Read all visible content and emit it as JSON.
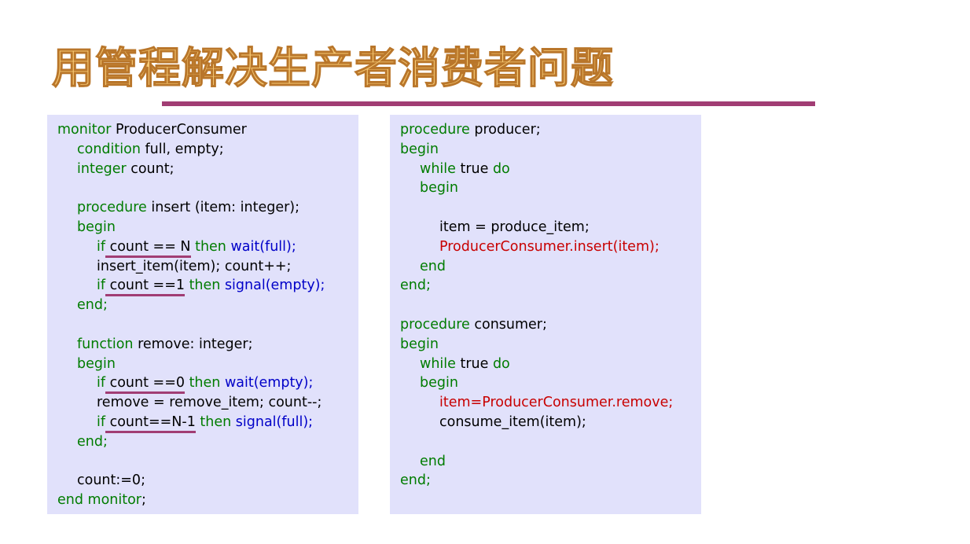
{
  "slide": {
    "title": "用管程解决生产者消费者问题"
  },
  "code_left": {
    "l01_kw": "monitor",
    "l01_tx": " ProducerConsumer",
    "l02_kw": "condition",
    "l02_tx": " full, empty;",
    "l03_kw": "integer",
    "l03_tx": " count;",
    "l05_kw": "procedure",
    "l05_tx": " insert (item: integer);",
    "l06_kw": "begin",
    "l07_if": "if",
    "l07_cond": " count == N",
    "l07_then": " then",
    "l07_call": " wait(full);",
    "l08_tx": "insert_item(item); count++;",
    "l09_if": "if",
    "l09_cond": " count ==1",
    "l09_then": " then",
    "l09_call": " signal(empty);",
    "l10_kw": "end;",
    "l12_kw": "function",
    "l12_tx": " remove: integer;",
    "l13_kw": "begin",
    "l14_if": "if",
    "l14_cond": " count ==0",
    "l14_then": " then",
    "l14_call": " wait(empty);",
    "l15_tx": "remove = remove_item; count--;",
    "l16_if": "if",
    "l16_cond": " count==N-1",
    "l16_then": " then",
    "l16_call": " signal(full);",
    "l17_kw": "end;",
    "l19_tx": "count:=0;",
    "l20_kw": "end monitor",
    "l20_tx": ";"
  },
  "code_right": {
    "r01_kw": "procedure",
    "r01_tx": " producer;",
    "r02_kw": "begin",
    "r03_kw1": "while",
    "r03_tx": " true",
    "r03_kw2": " do",
    "r04_kw": "begin",
    "r06_tx": "item = produce_item;",
    "r07_red": "ProducerConsumer.insert(item);",
    "r08_kw": "end",
    "r09_kw": "end;",
    "r11_kw": "procedure",
    "r11_tx": " consumer;",
    "r12_kw": "begin",
    "r13_kw1": "while",
    "r13_tx": " true",
    "r13_kw2": " do",
    "r14_kw": "begin",
    "r15_red": "item=ProducerConsumer.remove;",
    "r16_tx": "consume_item(item);",
    "r18_kw": "end",
    "r19_kw": "end;"
  },
  "colors": {
    "keyword": "#007c00",
    "operation": "#0000c8",
    "call_red": "#c80000",
    "panel_bg": "#e1e1fb",
    "accent_rule": "#a13d74",
    "title_fill": "#f6c873"
  }
}
